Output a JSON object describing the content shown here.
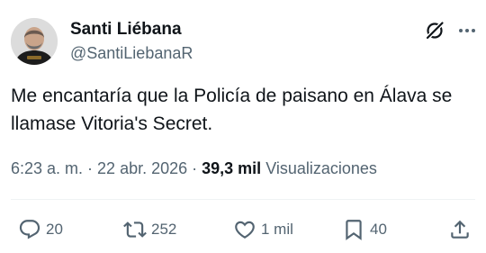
{
  "author": {
    "name": "Santi Liébana",
    "handle": "@SantiLiebanaR"
  },
  "tweet": {
    "text": "Me encantaría que la Policía de paisano en Álava se llamase Vitoria's Secret."
  },
  "meta": {
    "time": "6:23 a. m.",
    "separator1": " · ",
    "date": "22 abr. 2026",
    "separator2": " · ",
    "views_count": "39,3 mil",
    "views_label": " Visualizaciones"
  },
  "actions": {
    "replies": "20",
    "reposts": "252",
    "likes": "1 mil",
    "bookmarks": "40"
  },
  "icons": {
    "grok": "grok-icon",
    "more": "more-icon",
    "reply": "reply-icon",
    "repost": "repost-icon",
    "like": "heart-icon",
    "bookmark": "bookmark-icon",
    "share": "share-icon"
  },
  "colors": {
    "text_primary": "#0f1419",
    "text_secondary": "#536471",
    "divider": "#eff3f4"
  }
}
